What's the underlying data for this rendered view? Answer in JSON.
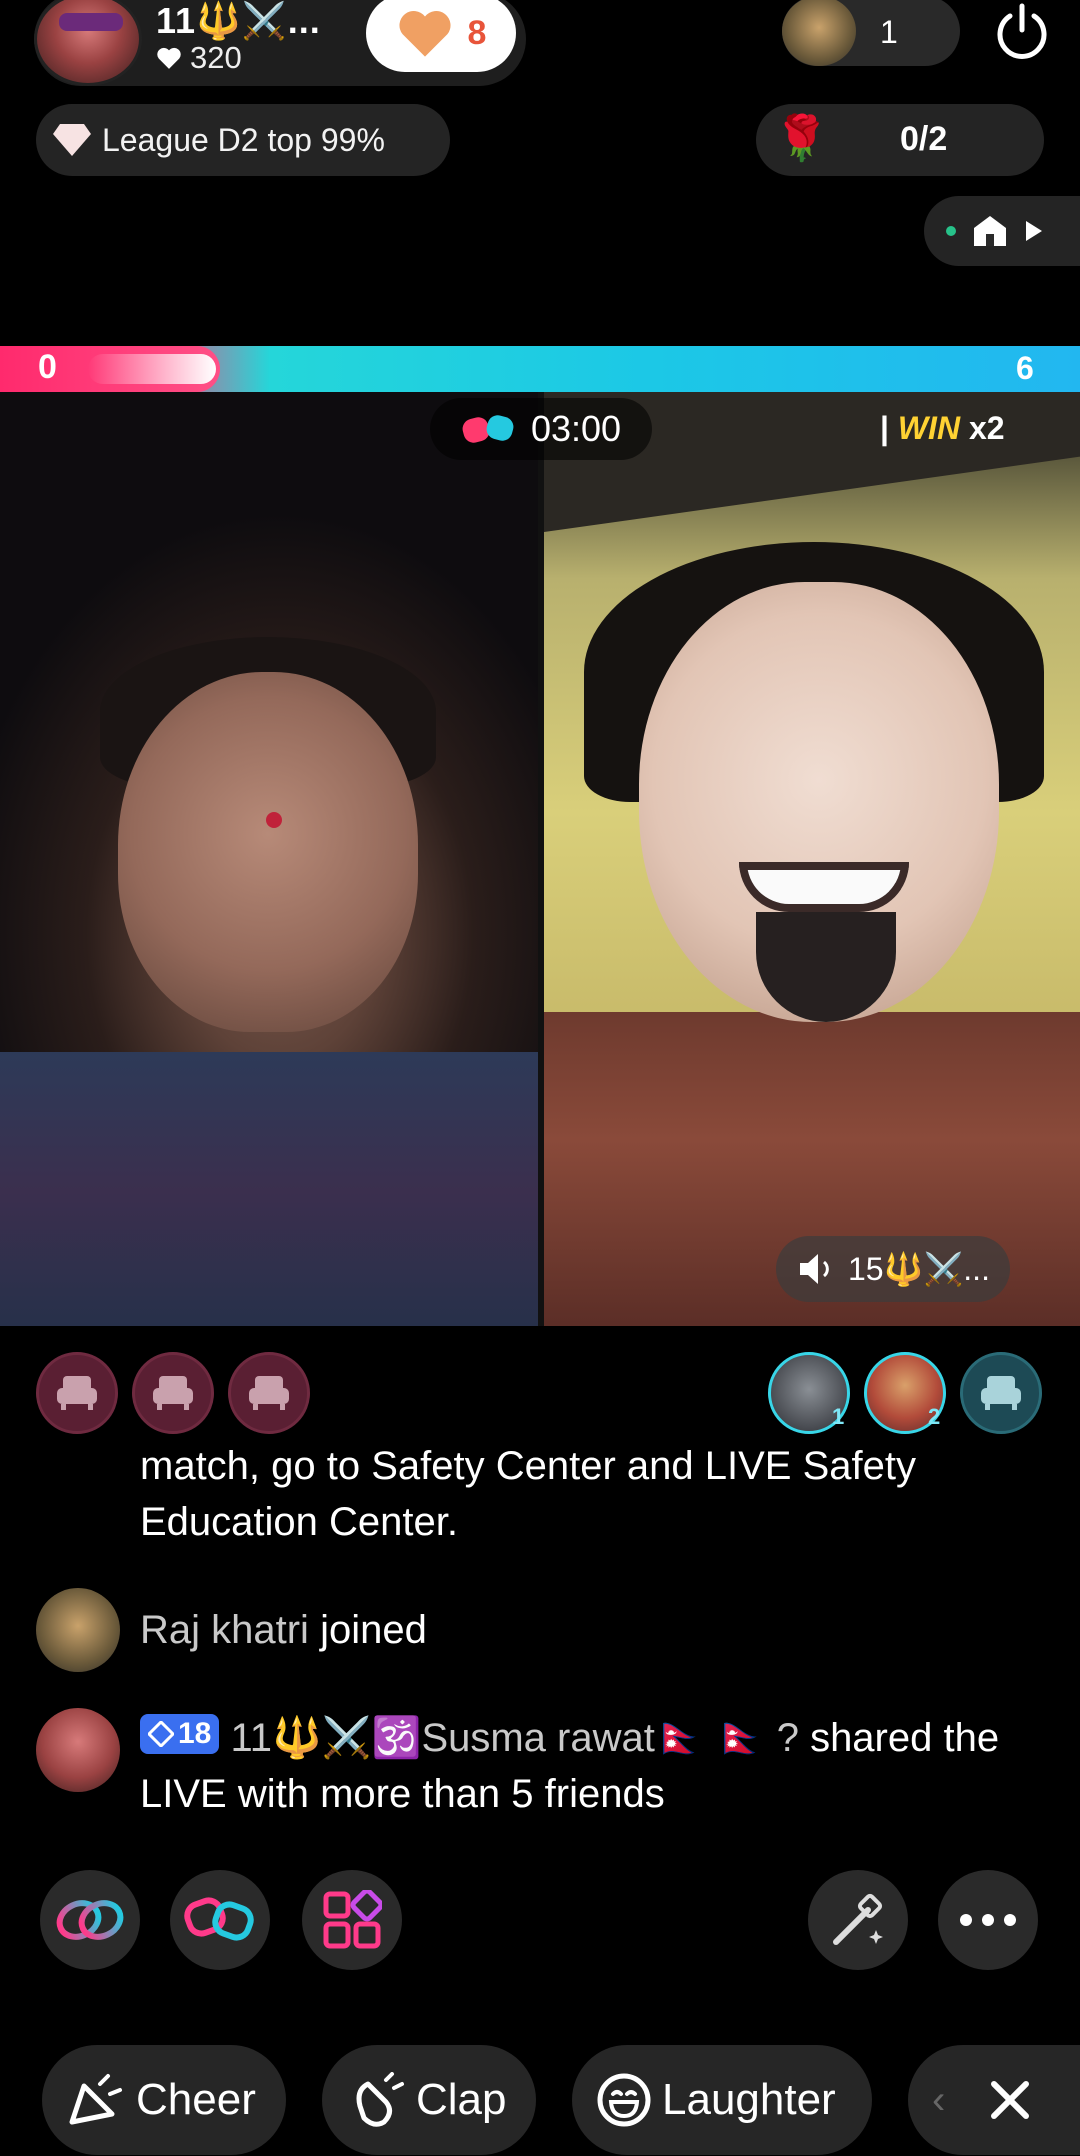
{
  "host": {
    "name": "11🔱⚔️...",
    "likes": "320",
    "heart_count": "8"
  },
  "viewers": {
    "count": "1"
  },
  "league": {
    "label": "League D2 top 99%"
  },
  "rose": {
    "count": "0/2"
  },
  "battle": {
    "score_left": "0",
    "score_right": "6",
    "timer": "03:00",
    "win_label": "WIN",
    "win_mult": "x2",
    "opponent_audio_label": "15🔱⚔️..."
  },
  "guests": {
    "ranks": [
      "1",
      "2"
    ]
  },
  "chat": [
    {
      "type": "notice",
      "text": "match, go to Safety Center and LIVE Safety Education Center."
    },
    {
      "type": "join",
      "name": "Raj khatri",
      "action": "joined"
    },
    {
      "type": "share",
      "level": "18",
      "name": "11🔱⚔️🕉️Susma rawat🇳🇵 🇳🇵 ?",
      "action": "shared the LIVE with more than 5 friends"
    }
  ],
  "reactions": [
    {
      "label": "Cheer"
    },
    {
      "label": "Clap"
    },
    {
      "label": "Laughter"
    }
  ],
  "colors": {
    "left_bar": "#ff2f7a",
    "right_bar": "#1cc8e6",
    "win_yellow": "#ffd233",
    "level_badge": "#3a6ff0"
  },
  "icons": {
    "like": "heart-icon",
    "power": "power-icon",
    "league": "diamond-icon",
    "rose": "rose-icon",
    "timer": "battle-gloves-icon",
    "audio": "speaker-icon",
    "seat": "armchair-icon",
    "link": "link-icon",
    "battle": "gloves-icon",
    "apps": "grid-icon",
    "effects": "magic-wand-icon",
    "more": "more-dots-icon",
    "close": "close-icon"
  }
}
